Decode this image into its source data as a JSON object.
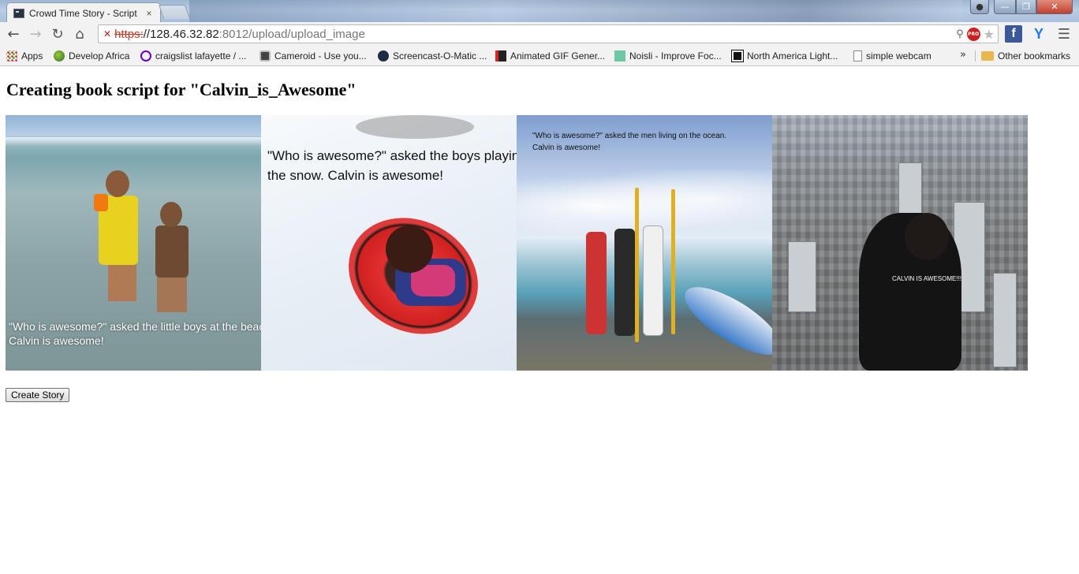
{
  "browser": {
    "tab_title": "Crowd Time Story - Script",
    "tab_close": "×",
    "url_scheme": "https:",
    "url_host": "//128.46.32.82",
    "url_rest": ":8012/upload/upload_image",
    "pro_badge": "PRO"
  },
  "bookmarks": [
    {
      "label": "Apps",
      "icon": "apps-icon"
    },
    {
      "label": "Develop Africa",
      "icon": "globe-icon"
    },
    {
      "label": "craigslist lafayette / ...",
      "icon": "peace-icon"
    },
    {
      "label": "Cameroid - Use you...",
      "icon": "camera-icon"
    },
    {
      "label": "Screencast-O-Matic ...",
      "icon": "som-icon"
    },
    {
      "label": "Animated GIF Gener...",
      "icon": "gif-icon"
    },
    {
      "label": "Noisli - Improve Foc...",
      "icon": "noisli-icon"
    },
    {
      "label": "North America Light...",
      "icon": "dsn-icon"
    },
    {
      "label": "simple webcam",
      "icon": "page-icon"
    }
  ],
  "bookmarks_more": "»",
  "other_bookmarks": "Other bookmarks",
  "page": {
    "title": "Creating book script for \"Calvin_is_Awesome\"",
    "photos": [
      {
        "caption_line1": "\"Who is awesome?\" asked the little boys at the beach.",
        "caption_line2": "Calvin is awesome!"
      },
      {
        "caption_line1": "\"Who is awesome?\" asked the boys playing in",
        "caption_line2": "the snow. Calvin is awesome!"
      },
      {
        "caption_line1": "\"Who is awesome?\" asked the men living on the ocean.",
        "caption_line2": "Calvin is awesome!"
      },
      {
        "caption_line1": "CALVIN IS AWESOME!!!",
        "caption_line2": ""
      }
    ],
    "create_button": "Create Story"
  }
}
